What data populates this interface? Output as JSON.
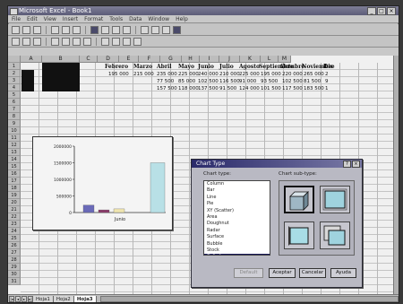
{
  "window": {
    "title": "Microsoft Excel - Book1"
  },
  "menubar": [
    "File",
    "Edit",
    "View",
    "Insert",
    "Format",
    "Tools",
    "Data",
    "Window",
    "Help"
  ],
  "spreadsheet": {
    "columns": [
      "A",
      "B",
      "C",
      "D",
      "E",
      "F",
      "G",
      "H",
      "I",
      "J",
      "K",
      "L",
      "M"
    ],
    "rows": [
      "1",
      "2",
      "3",
      "4",
      "5",
      "6",
      "7",
      "8",
      "9",
      "10",
      "11",
      "12",
      "13",
      "14",
      "15",
      "16",
      "17",
      "18",
      "19",
      "20",
      "21",
      "22",
      "23",
      "24",
      "25",
      "26",
      "27",
      "28",
      "29",
      "30",
      "31"
    ],
    "month_headers": [
      "Febrero",
      "Marzo",
      "Abril",
      "Mayo",
      "Junio",
      "Julio",
      "Agosto",
      "Septiembre",
      "Octubre",
      "Noviembre",
      "Dic"
    ],
    "data_rows": [
      [
        "195 000",
        "215 000",
        "235 000",
        "225 000",
        "240 000",
        "210 000",
        "225 000",
        "195 000",
        "220 000",
        "265 000",
        "2"
      ],
      [
        "",
        "",
        "77 500",
        "85 000",
        "102 500",
        "116 500",
        "91 000",
        "93 500",
        "102 500",
        "81 500",
        "9"
      ],
      [
        "",
        "",
        "157 500",
        "118 000",
        "137 500",
        "91 500",
        "124 000",
        "101 500",
        "117 500",
        "183 500",
        "1"
      ]
    ]
  },
  "chart_data": {
    "type": "bar",
    "categories": [
      "Junio"
    ],
    "series": [
      {
        "values": [
          225000
        ],
        "color": "#6a6ab8"
      },
      {
        "values": [
          80000
        ],
        "color": "#8b3a6a"
      },
      {
        "values": [
          110000
        ],
        "color": "#f0e6b0"
      },
      {
        "values": [
          1500000
        ],
        "color": "#b8e0e6"
      }
    ],
    "ylim": [
      0,
      2000000
    ],
    "yticks": [
      "0",
      "500000",
      "1000000",
      "1500000",
      "2000000"
    ],
    "xlabel": "Junio"
  },
  "dialog": {
    "title": "Chart Type",
    "chart_type_label": "Chart type:",
    "subtype_label": "Chart sub-type:",
    "chart_types": [
      "Column",
      "Bar",
      "Line",
      "Pie",
      "XY (Scatter)",
      "Area",
      "Doughnut",
      "Radar",
      "Surface",
      "Bubble",
      "Stock",
      "Cylinder",
      "Cone",
      "Pyramid"
    ],
    "selected_index": 11,
    "buttons": {
      "default": "Default",
      "ok": "Aceptar",
      "cancel": "Cancelar",
      "help": "Ayuda"
    }
  },
  "sheet_tabs": [
    "Hoja1",
    "Hoja2",
    "Hoja3"
  ],
  "active_tab": 2
}
